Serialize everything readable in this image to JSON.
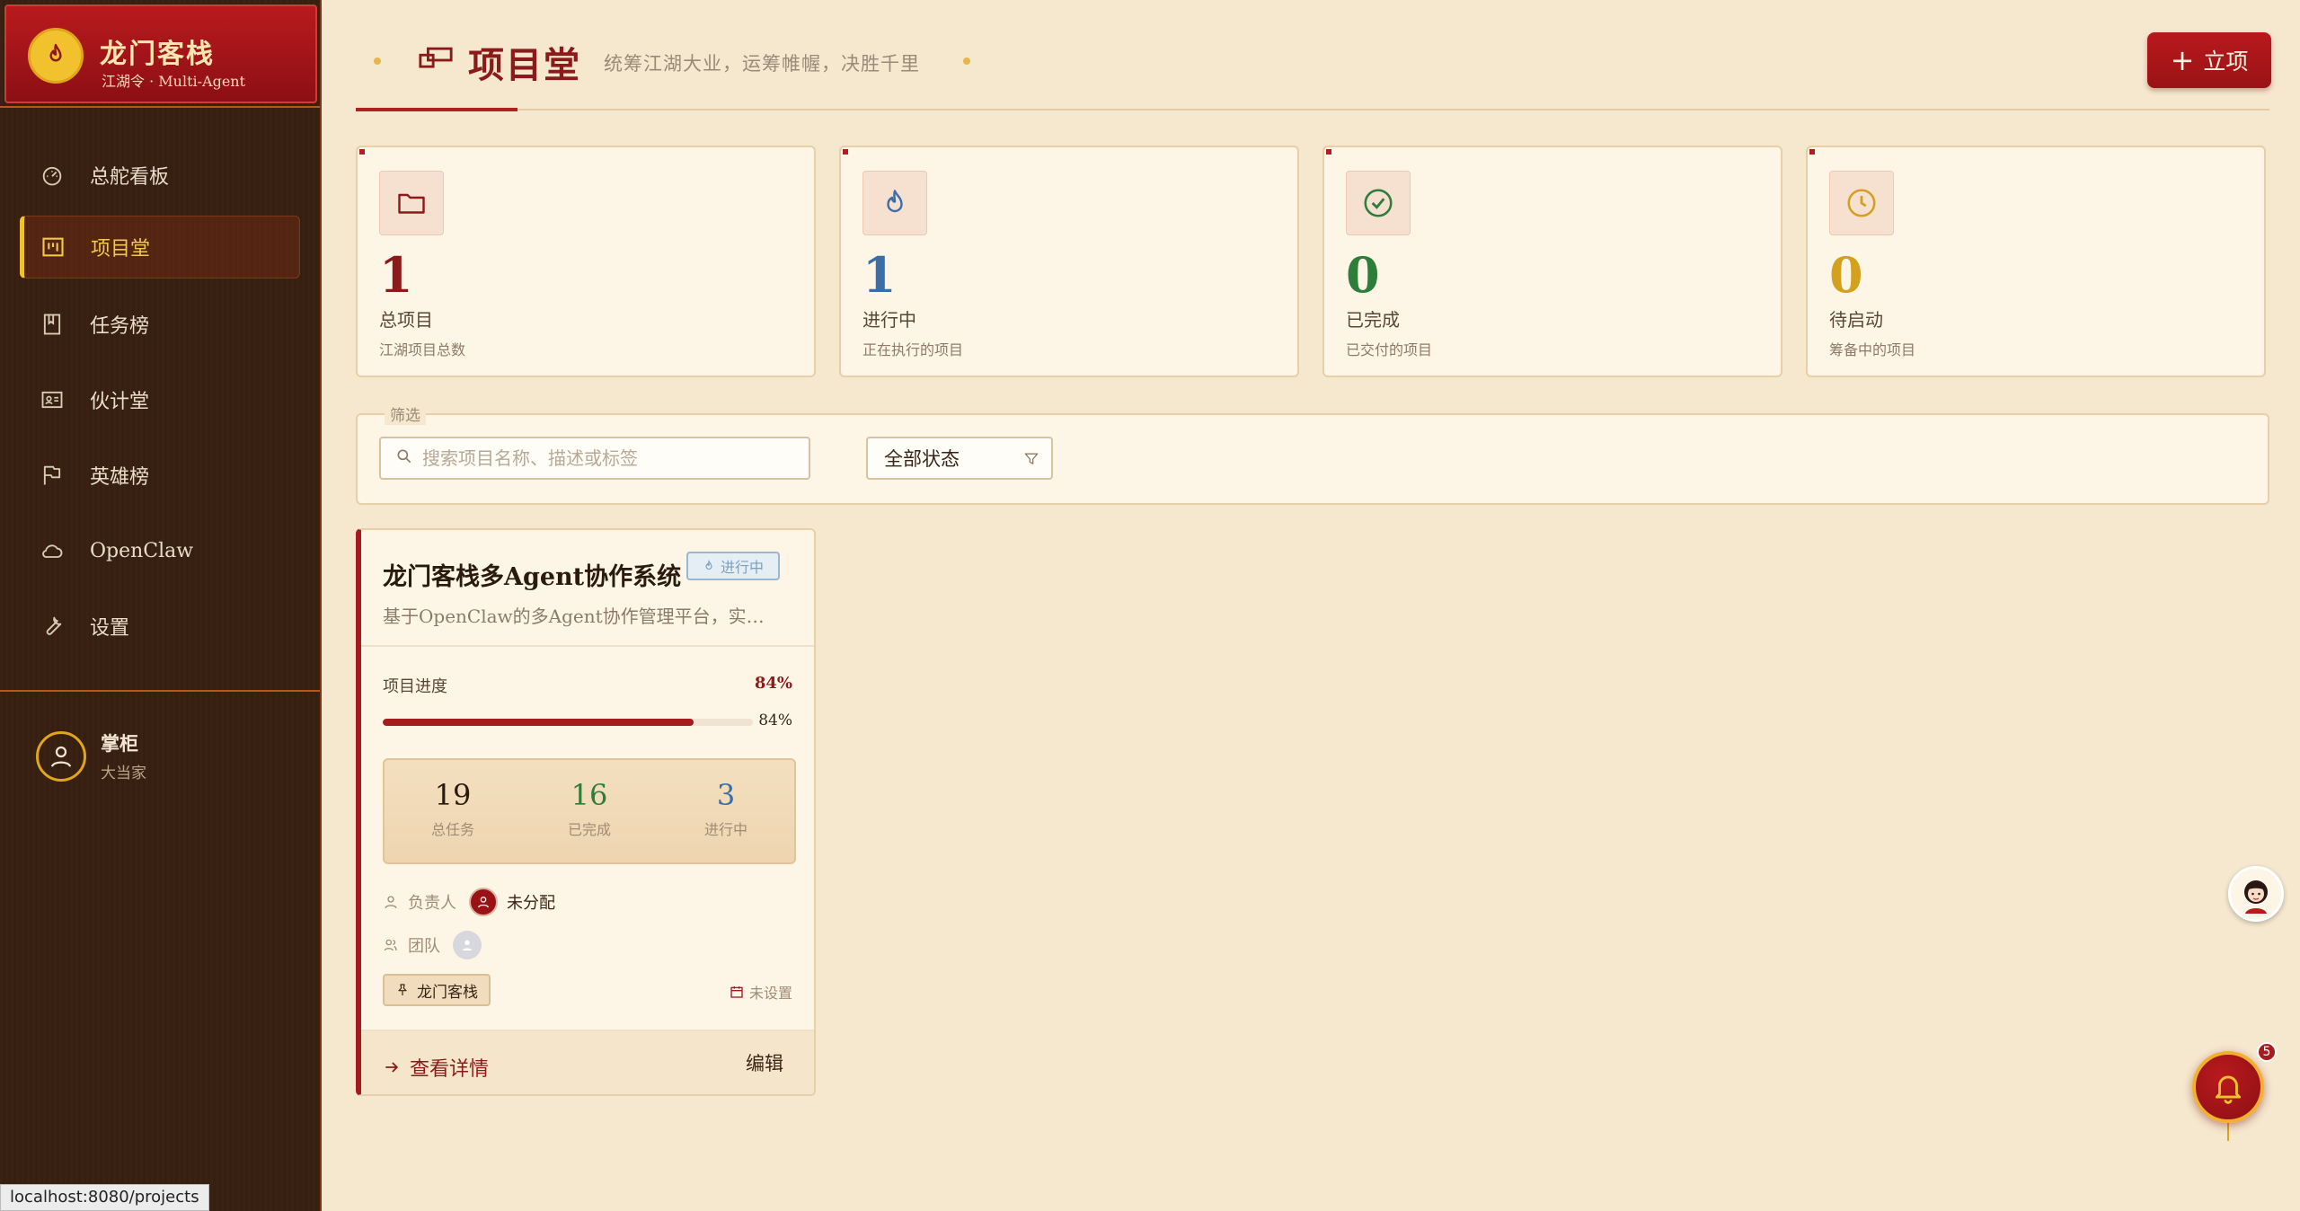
{
  "brand": {
    "title": "龙门客栈",
    "subtitle": "江湖令 · Multi-Agent"
  },
  "sidebar": {
    "items": [
      {
        "label": "总舵看板",
        "icon": "dashboard-icon"
      },
      {
        "label": "项目堂",
        "icon": "kanban-icon"
      },
      {
        "label": "任务榜",
        "icon": "book-icon"
      },
      {
        "label": "伙计堂",
        "icon": "id-card-icon"
      },
      {
        "label": "英雄榜",
        "icon": "flag-icon"
      },
      {
        "label": "OpenClaw",
        "icon": "cloud-icon"
      },
      {
        "label": "设置",
        "icon": "wrench-icon"
      }
    ],
    "active_index": 1
  },
  "user": {
    "name": "掌柜",
    "role": "大当家"
  },
  "status_url": "localhost:8080/projects",
  "header": {
    "title": "项目堂",
    "subtitle": "统筹江湖大业，运筹帷幄，决胜千里",
    "new_button": "立项"
  },
  "stats": [
    {
      "value": "1",
      "label": "总项目",
      "desc": "江湖项目总数",
      "color": "#8c1a1a",
      "icon": "folder-icon"
    },
    {
      "value": "1",
      "label": "进行中",
      "desc": "正在执行的项目",
      "color": "#3b6ea5",
      "icon": "flame-icon"
    },
    {
      "value": "0",
      "label": "已完成",
      "desc": "已交付的项目",
      "color": "#2f7d3a",
      "icon": "check-circle-icon"
    },
    {
      "value": "0",
      "label": "待启动",
      "desc": "筹备中的项目",
      "color": "#d4a020",
      "icon": "clock-icon"
    }
  ],
  "filter": {
    "legend": "筛选",
    "search_placeholder": "搜索项目名称、描述或标签",
    "status_value": "全部状态"
  },
  "project": {
    "title": "龙门客栈多Agent协作系统",
    "badge": "进行中",
    "description": "基于OpenClaw的多Agent协作管理平台，实现任…",
    "progress_label": "项目进度",
    "progress_percent": "84%",
    "progress_value": 0.84,
    "tasks": [
      {
        "value": "19",
        "label": "总任务",
        "color": "#2a1a10"
      },
      {
        "value": "16",
        "label": "已完成",
        "color": "#2f7d3a"
      },
      {
        "value": "3",
        "label": "进行中",
        "color": "#3b6ea5"
      }
    ],
    "owner_label": "负责人",
    "owner_value": "未分配",
    "team_label": "团队",
    "tag": "龙门客栈",
    "due": "未设置",
    "detail_link": "查看详情",
    "edit_link": "编辑"
  },
  "notifications": {
    "count": "5"
  }
}
